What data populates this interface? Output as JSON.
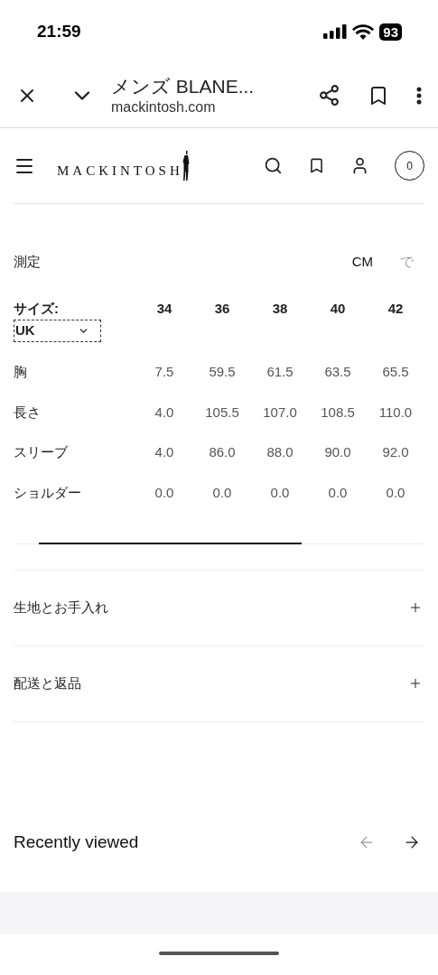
{
  "status_bar": {
    "time": "21:59",
    "battery": "93"
  },
  "browser_bar": {
    "title": "メンズ BLANE...",
    "url": "mackintosh.com"
  },
  "site_header": {
    "logo": "MACKINTOSH",
    "cart_count": "0"
  },
  "size_chart": {
    "title": "測定",
    "units": [
      {
        "label": "CM",
        "selected": true
      },
      {
        "label": "で",
        "selected": false
      }
    ],
    "size_label": "サイズ:",
    "size_system": "UK",
    "sizes": [
      "34",
      "36",
      "38",
      "40",
      "42"
    ],
    "rows": [
      {
        "label": "胸",
        "values": [
          "7.5",
          "59.5",
          "61.5",
          "63.5",
          "65.5"
        ]
      },
      {
        "label": "長さ",
        "values": [
          "4.0",
          "105.5",
          "107.0",
          "108.5",
          "110.0"
        ]
      },
      {
        "label": "スリーブ",
        "values": [
          "4.0",
          "86.0",
          "88.0",
          "90.0",
          "92.0"
        ]
      },
      {
        "label": "ショルダー",
        "values": [
          "0.0",
          "0.0",
          "0.0",
          "0.0",
          "0.0"
        ]
      }
    ]
  },
  "accordions": [
    {
      "label": "生地とお手入れ",
      "expanded": false
    },
    {
      "label": "配送と返品",
      "expanded": false
    }
  ],
  "recently_viewed": {
    "title": "Recently viewed",
    "prev_disabled": true,
    "next_disabled": false
  }
}
